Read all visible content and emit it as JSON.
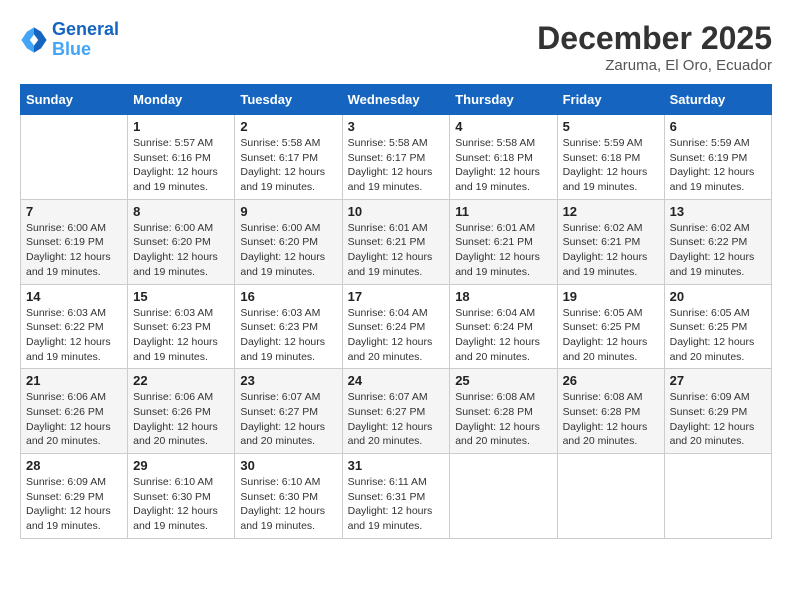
{
  "header": {
    "logo_line1": "General",
    "logo_line2": "Blue",
    "title": "December 2025",
    "subtitle": "Zaruma, El Oro, Ecuador"
  },
  "weekdays": [
    "Sunday",
    "Monday",
    "Tuesday",
    "Wednesday",
    "Thursday",
    "Friday",
    "Saturday"
  ],
  "weeks": [
    [
      {
        "day": "",
        "info": ""
      },
      {
        "day": "1",
        "info": "Sunrise: 5:57 AM\nSunset: 6:16 PM\nDaylight: 12 hours and 19 minutes."
      },
      {
        "day": "2",
        "info": "Sunrise: 5:58 AM\nSunset: 6:17 PM\nDaylight: 12 hours and 19 minutes."
      },
      {
        "day": "3",
        "info": "Sunrise: 5:58 AM\nSunset: 6:17 PM\nDaylight: 12 hours and 19 minutes."
      },
      {
        "day": "4",
        "info": "Sunrise: 5:58 AM\nSunset: 6:18 PM\nDaylight: 12 hours and 19 minutes."
      },
      {
        "day": "5",
        "info": "Sunrise: 5:59 AM\nSunset: 6:18 PM\nDaylight: 12 hours and 19 minutes."
      },
      {
        "day": "6",
        "info": "Sunrise: 5:59 AM\nSunset: 6:19 PM\nDaylight: 12 hours and 19 minutes."
      }
    ],
    [
      {
        "day": "7",
        "info": "Sunrise: 6:00 AM\nSunset: 6:19 PM\nDaylight: 12 hours and 19 minutes."
      },
      {
        "day": "8",
        "info": "Sunrise: 6:00 AM\nSunset: 6:20 PM\nDaylight: 12 hours and 19 minutes."
      },
      {
        "day": "9",
        "info": "Sunrise: 6:00 AM\nSunset: 6:20 PM\nDaylight: 12 hours and 19 minutes."
      },
      {
        "day": "10",
        "info": "Sunrise: 6:01 AM\nSunset: 6:21 PM\nDaylight: 12 hours and 19 minutes."
      },
      {
        "day": "11",
        "info": "Sunrise: 6:01 AM\nSunset: 6:21 PM\nDaylight: 12 hours and 19 minutes."
      },
      {
        "day": "12",
        "info": "Sunrise: 6:02 AM\nSunset: 6:21 PM\nDaylight: 12 hours and 19 minutes."
      },
      {
        "day": "13",
        "info": "Sunrise: 6:02 AM\nSunset: 6:22 PM\nDaylight: 12 hours and 19 minutes."
      }
    ],
    [
      {
        "day": "14",
        "info": "Sunrise: 6:03 AM\nSunset: 6:22 PM\nDaylight: 12 hours and 19 minutes."
      },
      {
        "day": "15",
        "info": "Sunrise: 6:03 AM\nSunset: 6:23 PM\nDaylight: 12 hours and 19 minutes."
      },
      {
        "day": "16",
        "info": "Sunrise: 6:03 AM\nSunset: 6:23 PM\nDaylight: 12 hours and 19 minutes."
      },
      {
        "day": "17",
        "info": "Sunrise: 6:04 AM\nSunset: 6:24 PM\nDaylight: 12 hours and 20 minutes."
      },
      {
        "day": "18",
        "info": "Sunrise: 6:04 AM\nSunset: 6:24 PM\nDaylight: 12 hours and 20 minutes."
      },
      {
        "day": "19",
        "info": "Sunrise: 6:05 AM\nSunset: 6:25 PM\nDaylight: 12 hours and 20 minutes."
      },
      {
        "day": "20",
        "info": "Sunrise: 6:05 AM\nSunset: 6:25 PM\nDaylight: 12 hours and 20 minutes."
      }
    ],
    [
      {
        "day": "21",
        "info": "Sunrise: 6:06 AM\nSunset: 6:26 PM\nDaylight: 12 hours and 20 minutes."
      },
      {
        "day": "22",
        "info": "Sunrise: 6:06 AM\nSunset: 6:26 PM\nDaylight: 12 hours and 20 minutes."
      },
      {
        "day": "23",
        "info": "Sunrise: 6:07 AM\nSunset: 6:27 PM\nDaylight: 12 hours and 20 minutes."
      },
      {
        "day": "24",
        "info": "Sunrise: 6:07 AM\nSunset: 6:27 PM\nDaylight: 12 hours and 20 minutes."
      },
      {
        "day": "25",
        "info": "Sunrise: 6:08 AM\nSunset: 6:28 PM\nDaylight: 12 hours and 20 minutes."
      },
      {
        "day": "26",
        "info": "Sunrise: 6:08 AM\nSunset: 6:28 PM\nDaylight: 12 hours and 20 minutes."
      },
      {
        "day": "27",
        "info": "Sunrise: 6:09 AM\nSunset: 6:29 PM\nDaylight: 12 hours and 20 minutes."
      }
    ],
    [
      {
        "day": "28",
        "info": "Sunrise: 6:09 AM\nSunset: 6:29 PM\nDaylight: 12 hours and 19 minutes."
      },
      {
        "day": "29",
        "info": "Sunrise: 6:10 AM\nSunset: 6:30 PM\nDaylight: 12 hours and 19 minutes."
      },
      {
        "day": "30",
        "info": "Sunrise: 6:10 AM\nSunset: 6:30 PM\nDaylight: 12 hours and 19 minutes."
      },
      {
        "day": "31",
        "info": "Sunrise: 6:11 AM\nSunset: 6:31 PM\nDaylight: 12 hours and 19 minutes."
      },
      {
        "day": "",
        "info": ""
      },
      {
        "day": "",
        "info": ""
      },
      {
        "day": "",
        "info": ""
      }
    ]
  ]
}
